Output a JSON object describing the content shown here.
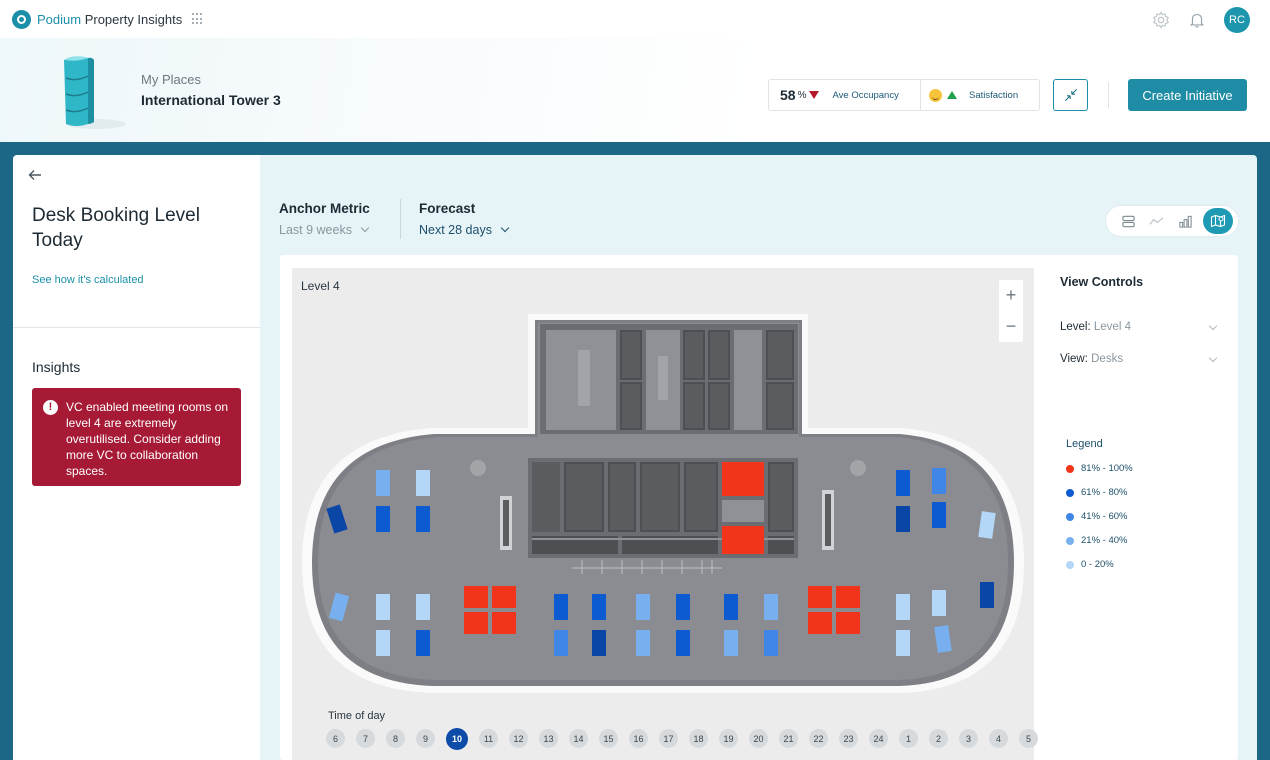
{
  "app": {
    "brand_first": "Podium",
    "brand_rest": " Property Insights",
    "user_initials": "RC"
  },
  "header": {
    "my_places": "My Places",
    "place_name": "International Tower 3",
    "occupancy_value": "58",
    "occupancy_unit": "%",
    "occupancy_label": "Ave Occupancy",
    "satisfaction_label": "Satisfaction",
    "create_button": "Create Initiative"
  },
  "left_panel": {
    "title": "Desk Booking Level Today",
    "calc_link": "See how it's calculated",
    "insights_heading": "Insights",
    "alert_text": "VC enabled meeting rooms on level 4 are extremely overutilised. Consider adding more VC to collaboration spaces."
  },
  "metrics_bar": {
    "anchor_label": "Anchor Metric",
    "anchor_value": "Last 9 weeks",
    "forecast_label": "Forecast",
    "forecast_value": "Next 28 days"
  },
  "map": {
    "level_label": "Level 4",
    "zoom_in": "+",
    "zoom_out": "−",
    "time_of_day_label": "Time of day",
    "hours": [
      "6",
      "7",
      "8",
      "9",
      "10",
      "11",
      "12",
      "13",
      "14",
      "15",
      "16",
      "17",
      "18",
      "19",
      "20",
      "21",
      "22",
      "23",
      "24",
      "1",
      "2",
      "3",
      "4",
      "5"
    ],
    "selected_hour": "10"
  },
  "view_controls": {
    "heading": "View Controls",
    "level_label": "Level:",
    "level_value": "Level 4",
    "view_label": "View:",
    "view_value": "Desks",
    "legend_heading": "Legend",
    "legend": [
      {
        "label": "81% - 100%",
        "color": "#f2341b"
      },
      {
        "label": "61% - 80%",
        "color": "#0d5bd0"
      },
      {
        "label": "41% - 60%",
        "color": "#3f86e6"
      },
      {
        "label": "21% - 40%",
        "color": "#78b0ef"
      },
      {
        "label": "0 - 20%",
        "color": "#b4d6f7"
      }
    ]
  },
  "colors": {
    "accent": "#1e8ca4",
    "frame": "#1b6785",
    "alert": "#a71a36",
    "selected_hour": "#0c4ba8"
  }
}
